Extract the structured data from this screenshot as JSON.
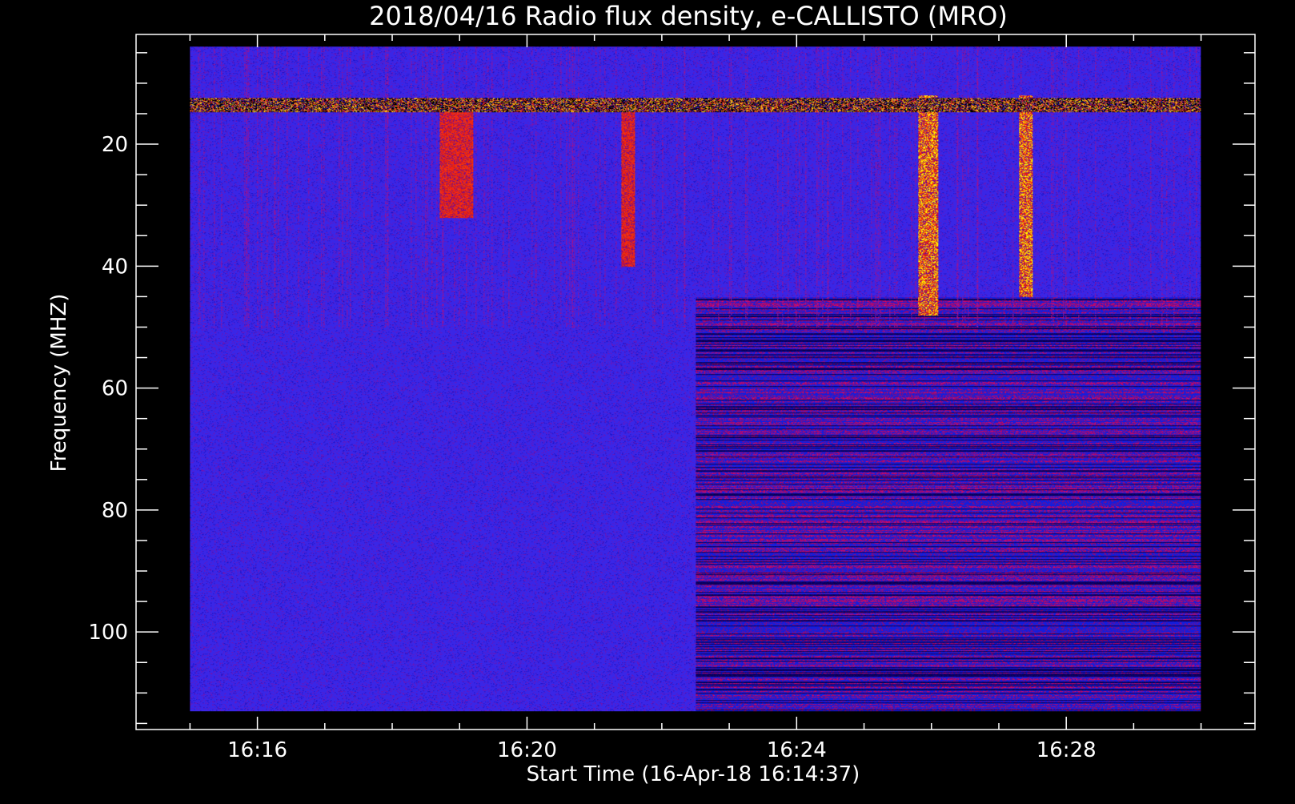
{
  "chart_data": {
    "type": "heatmap",
    "title": "2018/04/16  Radio flux density, e-CALLISTO (MRO)",
    "xlabel": "Start Time (16-Apr-18 16:14:37)",
    "ylabel": "Frequency (MHZ)",
    "x_ticks": [
      "16:16",
      "16:20",
      "16:24",
      "16:28"
    ],
    "x_tick_minutes": [
      16,
      20,
      24,
      28
    ],
    "x_data_range_minutes": [
      15.0,
      30.0
    ],
    "x_axis_range_minutes": [
      14.2,
      30.8
    ],
    "y_ticks": [
      "20",
      "40",
      "60",
      "80",
      "100"
    ],
    "y_tick_values": [
      20,
      40,
      60,
      80,
      100
    ],
    "y_data_range": [
      4,
      113
    ],
    "y_axis_range": [
      2,
      116
    ],
    "y_inverted": true,
    "colormap": [
      "#000000",
      "#0000ff",
      "#ff0000",
      "#ffff00"
    ],
    "background_level_color": "#3a26e6",
    "bursts": [
      {
        "t_start": 25.8,
        "t_end": 26.1,
        "f_low": 12,
        "f_high": 48,
        "kind": "type III burst"
      },
      {
        "t_start": 27.3,
        "t_end": 27.5,
        "f_low": 12,
        "f_high": 45,
        "kind": "type III burst"
      },
      {
        "t_start": 21.4,
        "t_end": 21.6,
        "f_low": 14,
        "f_high": 40,
        "kind": "faint burst"
      },
      {
        "t_start": 18.7,
        "t_end": 19.2,
        "f_low": 14,
        "f_high": 32,
        "kind": "faint burst"
      },
      {
        "t_start": 22.5,
        "t_end": 30.0,
        "f_low": 45,
        "f_high": 113,
        "kind": "broadband emission"
      }
    ],
    "interference_band_mhz": 13.5,
    "grid": false
  }
}
